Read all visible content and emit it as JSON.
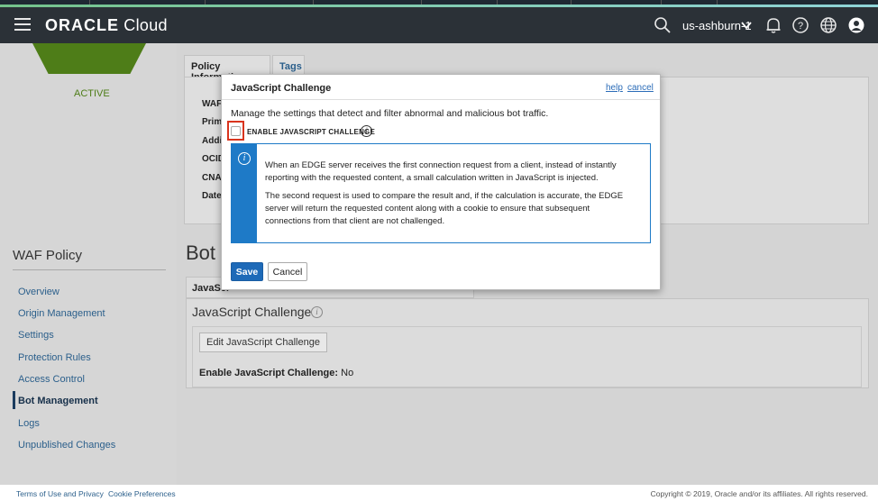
{
  "header": {
    "logo_bold": "ORACLE",
    "logo_light": " Cloud",
    "region": "us-ashburn-1"
  },
  "icons": {
    "menu": "hamburger-icon",
    "search": "search-icon",
    "region_caret": "chevron-down-icon",
    "notifications": "bell-icon",
    "help": "help-icon",
    "language": "globe-icon",
    "profile": "user-icon"
  },
  "colors": {
    "header_bg": "#2b3137",
    "accent_blue": "#1e7ac7",
    "save_blue": "#1e6ab8",
    "highlight_red": "#d9341e",
    "status_green": "#4e7d18"
  },
  "status": "ACTIVE",
  "policy_tabs": [
    "Policy Information",
    "Tags"
  ],
  "info_labels": [
    "WAF",
    "Prim",
    "Addi",
    "OCID",
    "CNA",
    "Date"
  ],
  "sidebar": {
    "title": "WAF Policy",
    "items": [
      {
        "label": "Overview"
      },
      {
        "label": "Origin Management"
      },
      {
        "label": "Settings"
      },
      {
        "label": "Protection Rules"
      },
      {
        "label": "Access Control"
      },
      {
        "label": "Bot Management"
      },
      {
        "label": "Logs"
      },
      {
        "label": "Unpublished Changes"
      }
    ]
  },
  "main": {
    "heading": "Bot",
    "sub_tab": "JavaScr",
    "section_title": "JavaScript Challenge",
    "edit_button": "Edit JavaScript Challenge",
    "enable_label": "Enable JavaScript Challenge:",
    "enable_value": "No"
  },
  "modal": {
    "title": "JavaScript Challenge",
    "help_link": "help",
    "cancel_link": "cancel",
    "description": "Manage the settings that detect and filter abnormal and malicious bot traffic.",
    "checkbox_label": "ENABLE JAVASCRIPT CHALLENGE",
    "info_para1": "When an EDGE server receives the first connection request from a client, instead of instantly reporting with the requested content, a small calculation written in JavaScript is injected.",
    "info_para2": "The second request is used to compare the result and, if the calculation is accurate, the EDGE server will return the requested content along with a cookie to ensure that subsequent connections from that client are not challenged.",
    "save_button": "Save",
    "cancel_button": "Cancel"
  },
  "footer": {
    "terms": "Terms of Use and Privacy",
    "cookies": "Cookie Preferences",
    "copyright": "Copyright © 2019, Oracle and/or its affiliates. All rights reserved."
  }
}
